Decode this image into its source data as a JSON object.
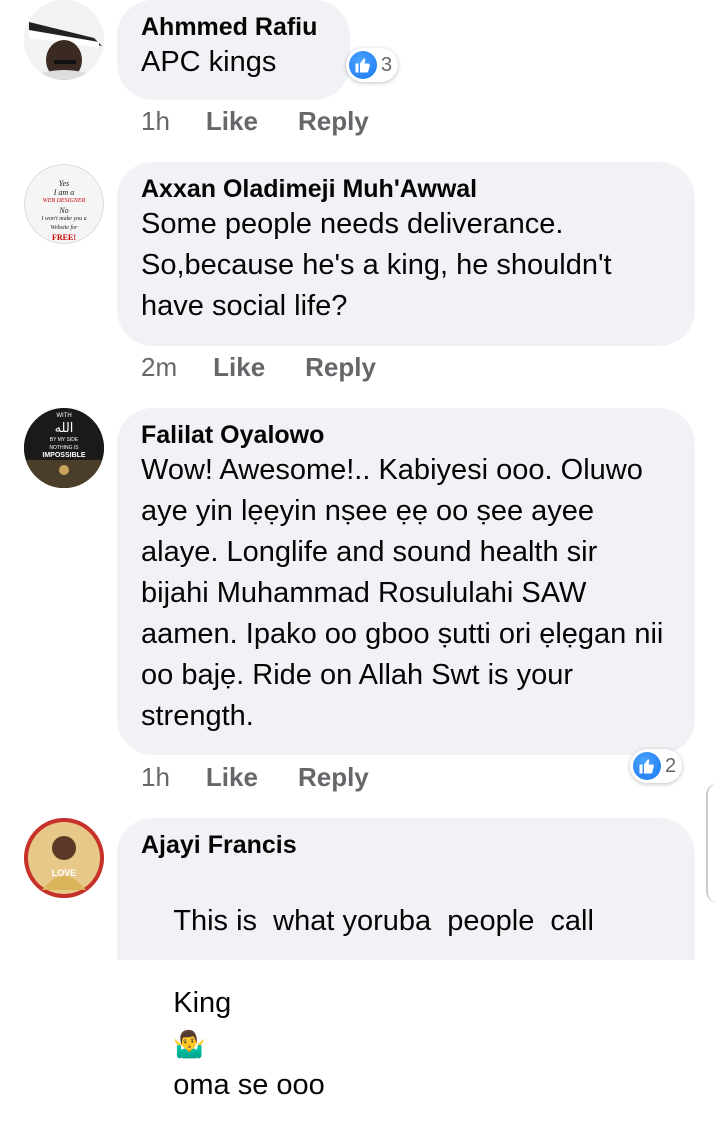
{
  "comments": [
    {
      "author": "Ahmmed Rafiu",
      "text": "APC kings",
      "time": "1h",
      "like": "Like",
      "reply": "Reply",
      "reactions": "3"
    },
    {
      "author": "Axxan Oladimeji Muh'Awwal",
      "text": "Some people needs deliverance. So,because he's a king, he shouldn't have social life?",
      "time": "2m",
      "like": "Like",
      "reply": "Reply",
      "avatar_text": [
        "Yes",
        "I am a",
        "WEB DESIGNER",
        "No",
        "I won't make you a",
        "Website for",
        "FREE!"
      ]
    },
    {
      "author": "Falilat Oyalowo",
      "text": "Wow! Awesome!.. Kabiyesi ooo. Oluwo aye yin lẹẹyin nṣee ẹẹ oo ṣee ayee alaye. Longlife and sound health sir bijahi Muhammad Rosululahi SAW aamen. Ipako oo gboo ṣutti ori ẹlẹgan nii oo bajẹ. Ride on Allah Swt is your strength.",
      "time": "1h",
      "like": "Like",
      "reply": "Reply",
      "reactions": "2",
      "avatar_text": [
        "WITH",
        "الله",
        "BY MY SIDE",
        "NOTHING IS",
        "IMPOSSIBLE"
      ]
    },
    {
      "author": "Ajayi Francis",
      "text_part1": "This is  what yoruba  people  call",
      "text_part2": "King",
      "emoji": "🤷‍♂️",
      "text_part3": "oma se ooo",
      "avatar_text": [
        "LOVE"
      ]
    }
  ],
  "colors": {
    "bubble": "#f0f2f5",
    "meta": "#65676b",
    "like_blue": "#1877f2"
  },
  "icons": [
    "thumbs-up-icon"
  ]
}
